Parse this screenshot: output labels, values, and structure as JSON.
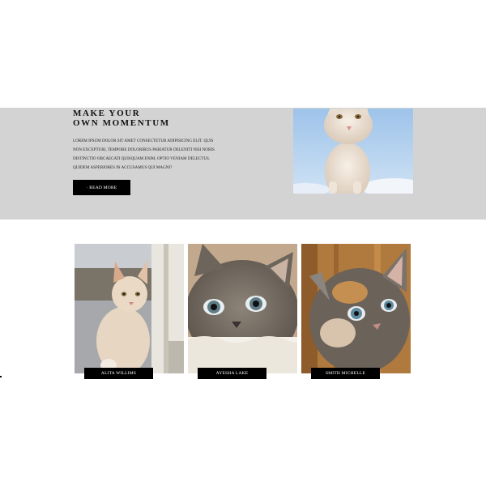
{
  "hero": {
    "title_line1": "MAKE YOUR",
    "title_line2": "OWN MOMENTUM",
    "text": "LOREM IPSUM DOLOR SIT AMET CONSECTETUR ADIPISICING ELIT. QUIS NON EXCEPTURI, TEMPORE DOLORIBUS PARIATUR DELENITI NISI NOBIS DISTINCTIO OBCAECATI QUISQUAM ENIM, OPTIO VENIAM DELECTUS. QUIDEM ASPERIORES IN ACCUSAMUS QUI MAGNI?",
    "button_label": "· READ MORE",
    "background_color": "#d3d3d3"
  },
  "team": [
    {
      "name": "ALITA WILLIMS"
    },
    {
      "name": "AYESHA LAKE"
    },
    {
      "name": "SMITH MICHELLE"
    }
  ],
  "accent": "#000000"
}
